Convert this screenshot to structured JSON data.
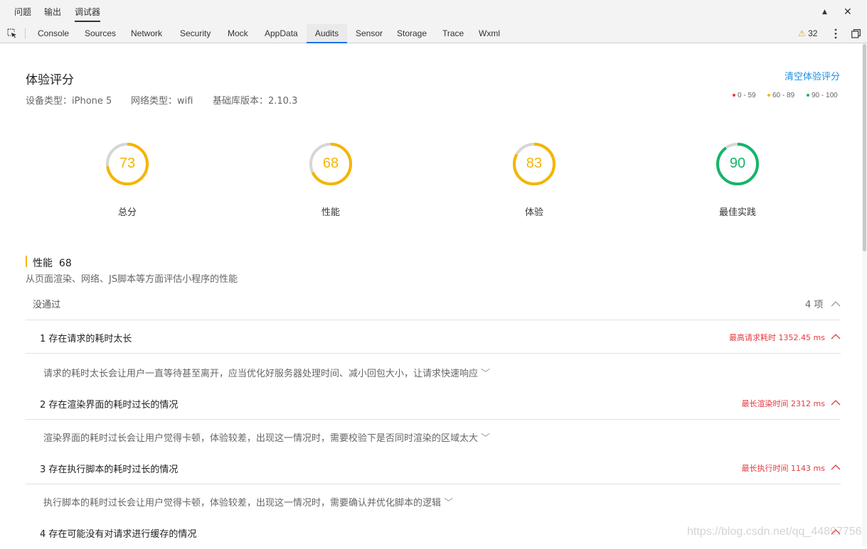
{
  "drawer": {
    "tabs": [
      "问题",
      "输出",
      "调试器"
    ],
    "active": "调试器",
    "minimize_icon": "triangle-up-icon",
    "close_icon": "close-icon"
  },
  "panels": {
    "tabs": [
      "Console",
      "Sources",
      "Network",
      "Security",
      "Mock",
      "AppData",
      "Audits",
      "Sensor",
      "Storage",
      "Trace",
      "Wxml"
    ],
    "active": "Audits",
    "warning_count": "32"
  },
  "report": {
    "title": "体验评分",
    "clear_label": "清空体验评分",
    "device": "设备类型：iPhone 5",
    "network": "网络类型：wifi",
    "lib_version": "基础库版本：2.10.3",
    "legend": [
      {
        "label": "0 - 59",
        "color": "#e5393f"
      },
      {
        "label": "60 - 89",
        "color": "#f5b500"
      },
      {
        "label": "90 - 100",
        "color": "#15b56a"
      }
    ],
    "scores": [
      {
        "label": "总分",
        "value": "73",
        "fraction": 0.73,
        "color": "#f5b500"
      },
      {
        "label": "性能",
        "value": "68",
        "fraction": 0.68,
        "color": "#f5b500"
      },
      {
        "label": "体验",
        "value": "83",
        "fraction": 0.83,
        "color": "#f5b500"
      },
      {
        "label": "最佳实践",
        "value": "90",
        "fraction": 0.9,
        "color": "#15b56a"
      }
    ]
  },
  "section": {
    "title": "性能",
    "score": "68",
    "desc": "从页面渲染、网络、JS脚本等方面评估小程序的性能",
    "failed_label": "没通过",
    "failed_count": "4 项"
  },
  "audits": [
    {
      "title": "1 存在请求的耗时太长",
      "value": "最高请求耗时 1352.45 ms",
      "desc": "请求的耗时太长会让用户一直等待甚至离开，应当优化好服务器处理时间、减小回包大小，让请求快速响应"
    },
    {
      "title": "2 存在渲染界面的耗时过长的情况",
      "value": "最长渲染时间 2312 ms",
      "desc": "渲染界面的耗时过长会让用户觉得卡顿，体验较差，出现这一情况时，需要校验下是否同时渲染的区域太大"
    },
    {
      "title": "3 存在执行脚本的耗时过长的情况",
      "value": "最长执行时间 1143 ms",
      "desc": "执行脚本的耗时过长会让用户觉得卡顿，体验较差，出现这一情况时，需要确认并优化脚本的逻辑"
    },
    {
      "title": "4 存在可能没有对请求进行缓存的情况",
      "value": "",
      "desc": ""
    }
  ],
  "watermark": "https://blog.csdn.net/qq_44897756"
}
